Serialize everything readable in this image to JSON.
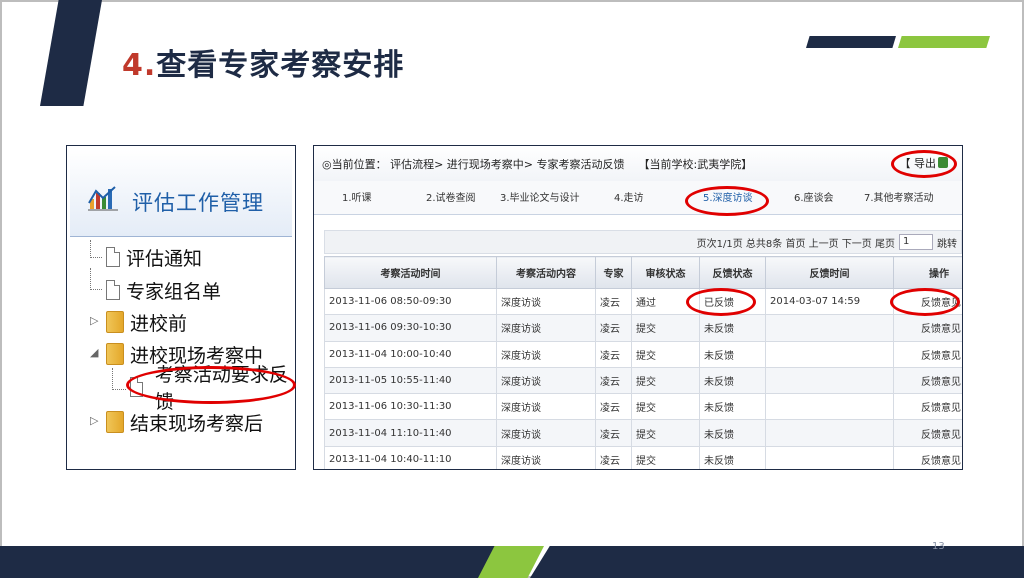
{
  "slide": {
    "number_prefix": "4.",
    "title": "查看专家考察安排",
    "page_number": "13"
  },
  "left_menu": {
    "title": "评估工作管理",
    "items": [
      {
        "label": "评估通知",
        "type": "doc"
      },
      {
        "label": "专家组名单",
        "type": "doc"
      },
      {
        "label": "进校前",
        "type": "folder",
        "expander": "▷"
      },
      {
        "label": "进校现场考察中",
        "type": "folder",
        "expander": "◢"
      },
      {
        "label": "考察活动要求反馈",
        "type": "doc",
        "highlighted": true
      },
      {
        "label": "结束现场考察后",
        "type": "folder",
        "expander": "▷"
      }
    ]
  },
  "app": {
    "breadcrumb": "◎当前位置： 评估流程> 进行现场考察中> 专家考察活动反馈",
    "current_school": "【当前学校:武夷学院】",
    "export_label": "【 导出",
    "tabs": [
      {
        "label": "1.听课"
      },
      {
        "label": "2.试卷查阅"
      },
      {
        "label": "3.毕业论文与设计"
      },
      {
        "label": "4.走访"
      },
      {
        "label": "5.深度访谈",
        "active": true
      },
      {
        "label": "6.座谈会"
      },
      {
        "label": "7.其他考察活动"
      }
    ],
    "pager": {
      "text": "页次1/1页 总共8条 首页 上一页 下一页 尾页",
      "page_input": "1",
      "jump_label": "跳转"
    },
    "table": {
      "columns": [
        "考察活动时间",
        "考察活动内容",
        "专家",
        "审核状态",
        "反馈状态",
        "反馈时间",
        "操作"
      ],
      "rows": [
        [
          "2013-11-06 08:50-09:30",
          "深度访谈",
          "凌云",
          "通过",
          "已反馈",
          "2014-03-07 14:59",
          "反馈意见"
        ],
        [
          "2013-11-06 09:30-10:30",
          "深度访谈",
          "凌云",
          "提交",
          "未反馈",
          "",
          "反馈意见"
        ],
        [
          "2013-11-04 10:00-10:40",
          "深度访谈",
          "凌云",
          "提交",
          "未反馈",
          "",
          "反馈意见"
        ],
        [
          "2013-11-05 10:55-11:40",
          "深度访谈",
          "凌云",
          "提交",
          "未反馈",
          "",
          "反馈意见"
        ],
        [
          "2013-11-06 10:30-11:30",
          "深度访谈",
          "凌云",
          "提交",
          "未反馈",
          "",
          "反馈意见"
        ],
        [
          "2013-11-04 11:10-11:40",
          "深度访谈",
          "凌云",
          "提交",
          "未反馈",
          "",
          "反馈意见"
        ],
        [
          "2013-11-04 10:40-11:10",
          "深度访谈",
          "凌云",
          "提交",
          "未反馈",
          "",
          "反馈意见"
        ]
      ]
    }
  },
  "colors": {
    "navy": "#1e2b45",
    "green": "#8cc63f",
    "title_number_red": "#c0392b",
    "highlight_circle": "#e00000",
    "link_blue": "#1f5fa8"
  }
}
